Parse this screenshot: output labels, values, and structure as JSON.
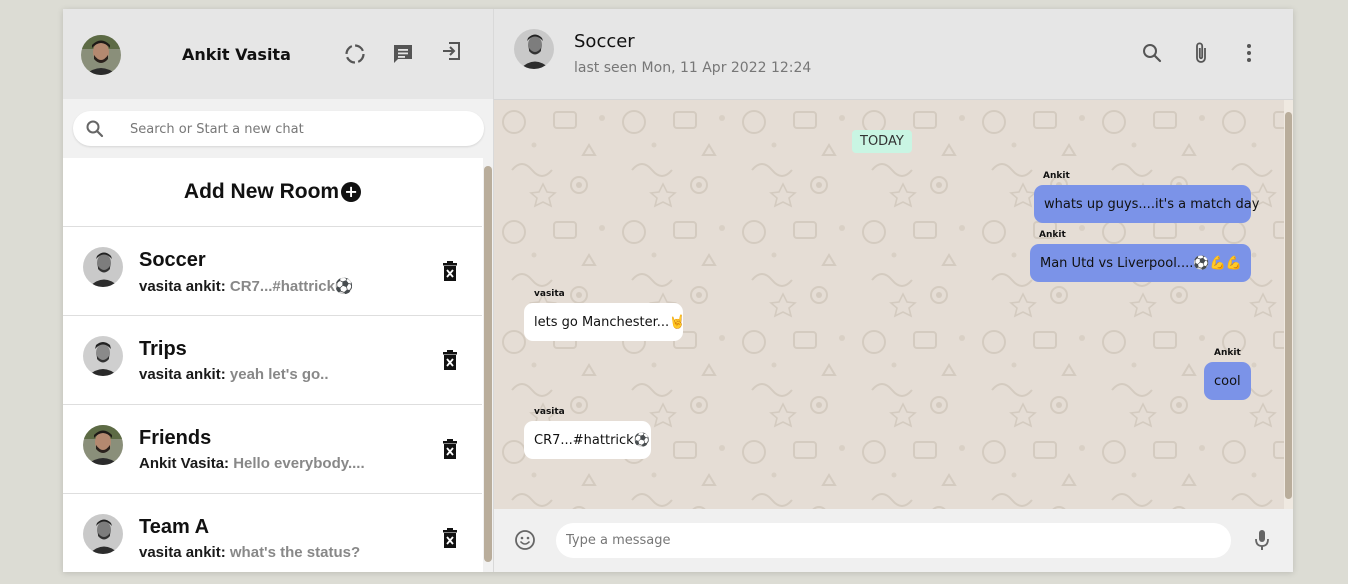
{
  "user": {
    "name": "Ankit Vasita"
  },
  "search": {
    "placeholder": "Search or Start a new chat"
  },
  "add_room": {
    "label": "Add New Room"
  },
  "rooms": [
    {
      "name": "Soccer",
      "sender": "vasita ankit:",
      "last": "CR7...#hattrick⚽"
    },
    {
      "name": "Trips",
      "sender": "vasita ankit:",
      "last": "yeah let's go.."
    },
    {
      "name": "Friends",
      "sender": "Ankit Vasita:",
      "last": "Hello everybody...."
    },
    {
      "name": "Team A",
      "sender": "vasita ankit:",
      "last": "what's the status?"
    }
  ],
  "chat": {
    "title": "Soccer",
    "last_seen": "last seen Mon, 11 Apr 2022 12:24",
    "date_chip": "TODAY",
    "messages": [
      {
        "sender": "Ankit",
        "text": "whats up guys....it's a match day",
        "mine": true
      },
      {
        "sender": "Ankit",
        "text": "Man Utd vs Liverpool....⚽💪💪",
        "mine": true
      },
      {
        "sender": "vasita",
        "text": "lets go Manchester...🤘",
        "mine": false
      },
      {
        "sender": "Ankit",
        "text": "cool",
        "mine": true
      },
      {
        "sender": "vasita",
        "text": "CR7...#hattrick⚽",
        "mine": false
      }
    ],
    "input_placeholder": "Type a message"
  },
  "colors": {
    "my_bubble": "#7b93e8",
    "date_chip": "#c9f5e3",
    "header_bg": "#e6e6e6"
  }
}
